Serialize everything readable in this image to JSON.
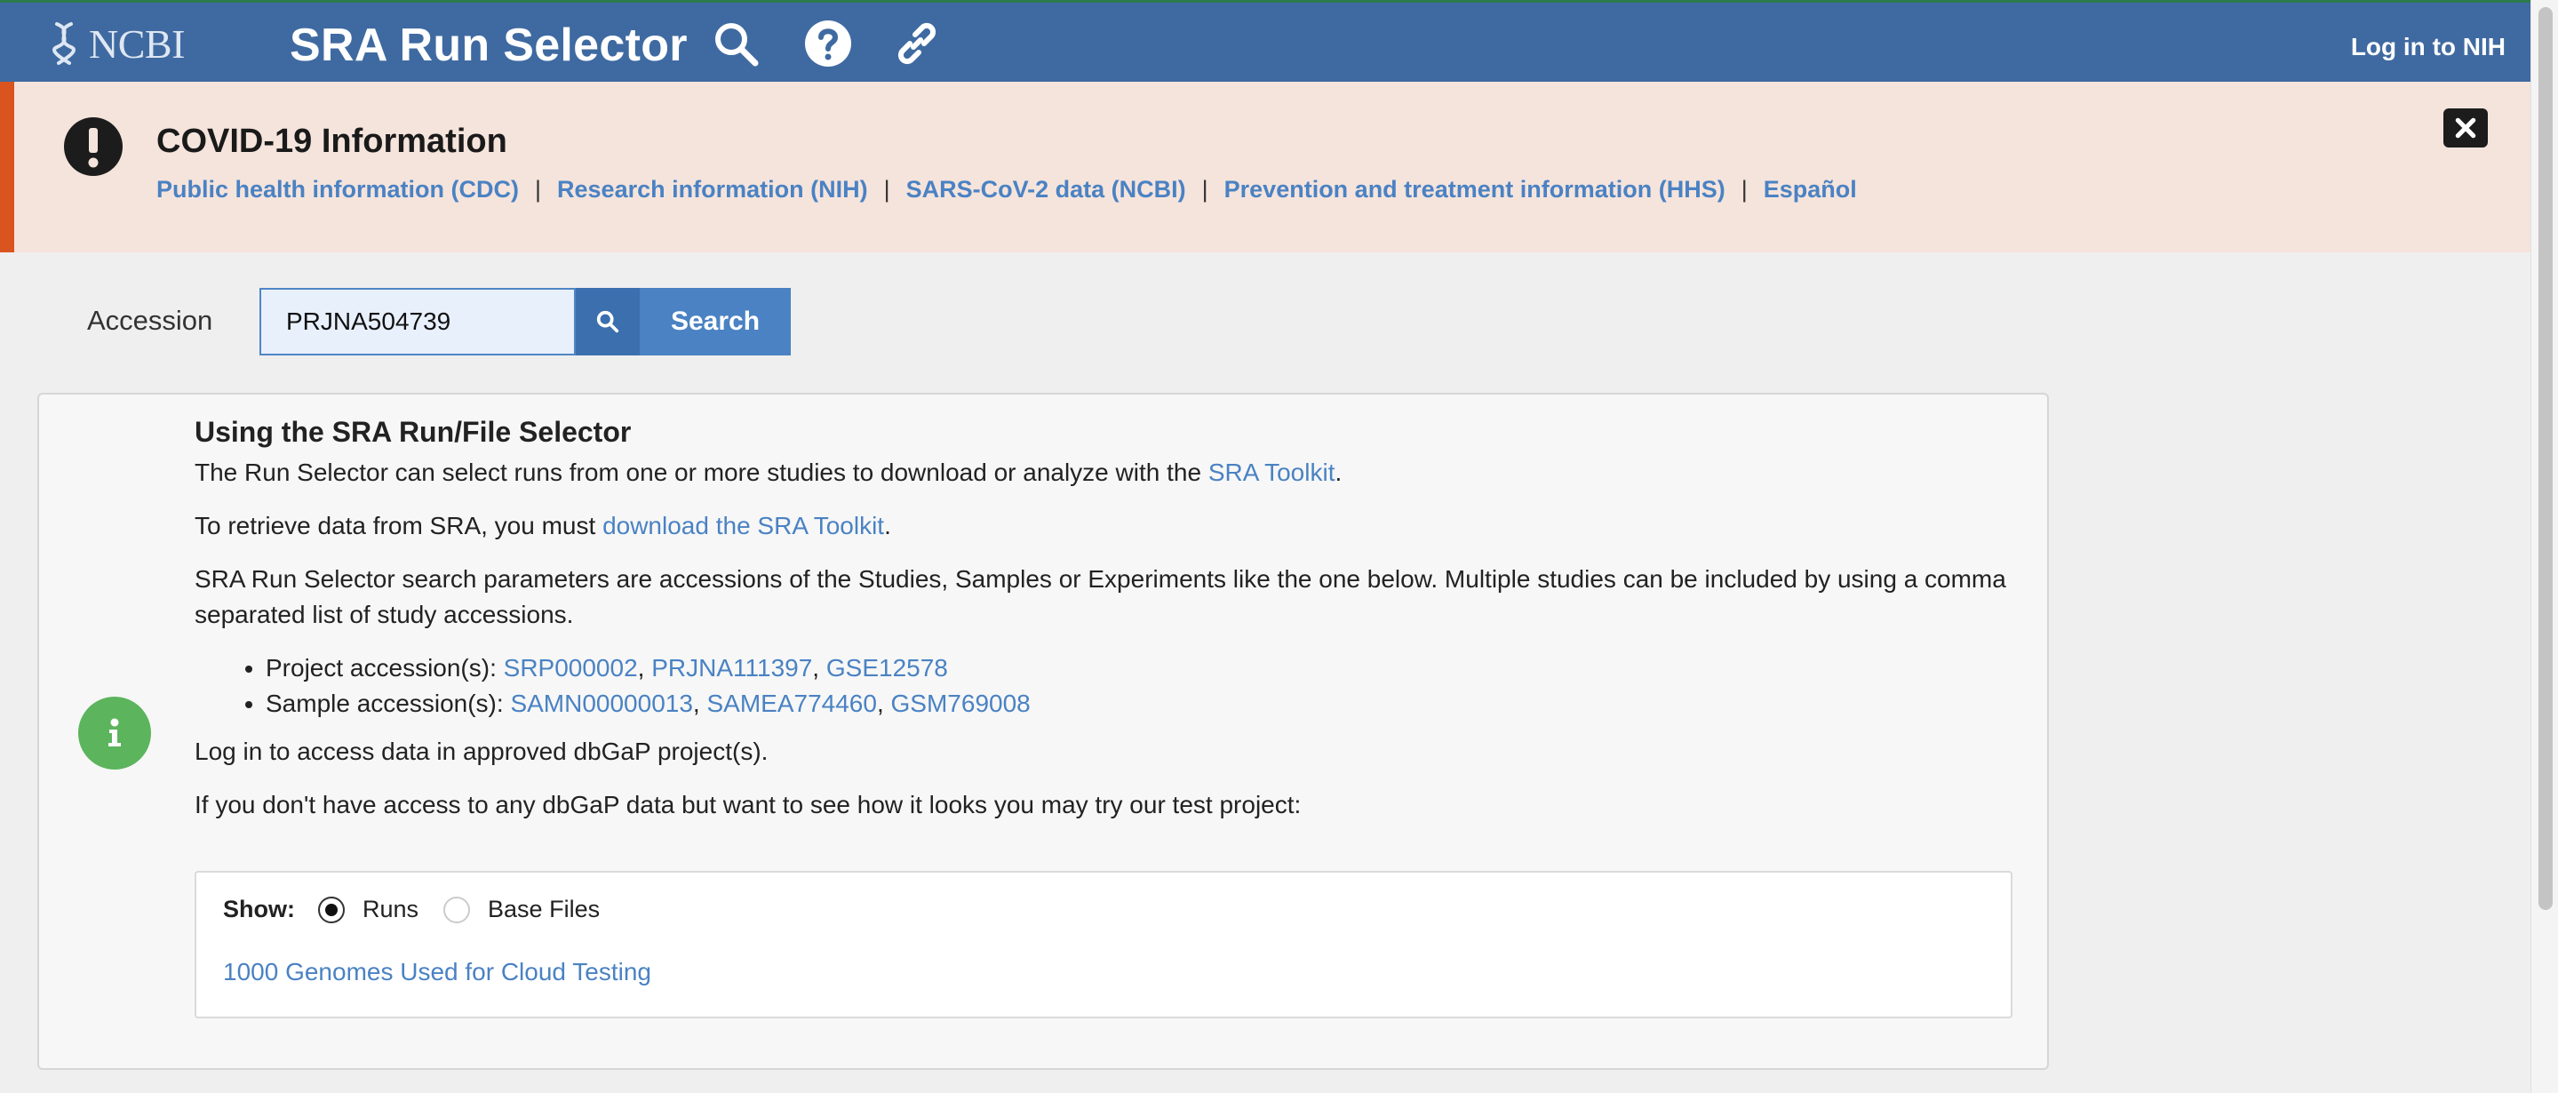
{
  "header": {
    "logo_text": "NCBI",
    "title": "SRA Run Selector",
    "login_label": "Log in to NIH",
    "icons": [
      "search-icon",
      "help-icon",
      "link-icon"
    ]
  },
  "banner": {
    "title": "COVID-19 Information",
    "links": [
      "Public health information (CDC)",
      "Research information (NIH)",
      "SARS-CoV-2 data (NCBI)",
      "Prevention and treatment information (HHS)",
      "Español"
    ],
    "separator": "|"
  },
  "search": {
    "label": "Accession",
    "value": "PRJNA504739",
    "button_label": "Search"
  },
  "info": {
    "heading": "Using the SRA Run/File Selector",
    "p1_text": "The Run Selector can select runs from one or more studies to download or analyze with the ",
    "p1_link": "SRA Toolkit",
    "p1_end": ".",
    "p2_text": "To retrieve data from SRA, you must ",
    "p2_link": "download the SRA Toolkit",
    "p2_end": ".",
    "p3_text": "SRA Run Selector search parameters are accessions of the Studies, Samples or Experiments like the one below. Multiple studies can be included by using a comma separated list of study accessions.",
    "project_label": "Project accession(s): ",
    "project_links": [
      "SRP000002",
      "PRJNA111397",
      "GSE12578"
    ],
    "sample_label": "Sample accession(s): ",
    "sample_links": [
      "SAMN00000013",
      "SAMEA774460",
      "GSM769008"
    ],
    "comma": ", ",
    "p4_text": "Log in to access data in approved dbGaP project(s).",
    "p5_text": "If you don't have access to any dbGaP data but want to see how it looks you may try our test project:"
  },
  "test_box": {
    "show_label": "Show:",
    "options": [
      "Runs",
      "Base Files"
    ],
    "selected": "Runs",
    "link": "1000 Genomes Used for Cloud Testing"
  },
  "colors": {
    "header_bg": "#3f6aa1",
    "banner_bg": "#f5e4dc",
    "banner_accent": "#d9541e",
    "link": "#4a82c3",
    "info_icon": "#5cb45c"
  }
}
